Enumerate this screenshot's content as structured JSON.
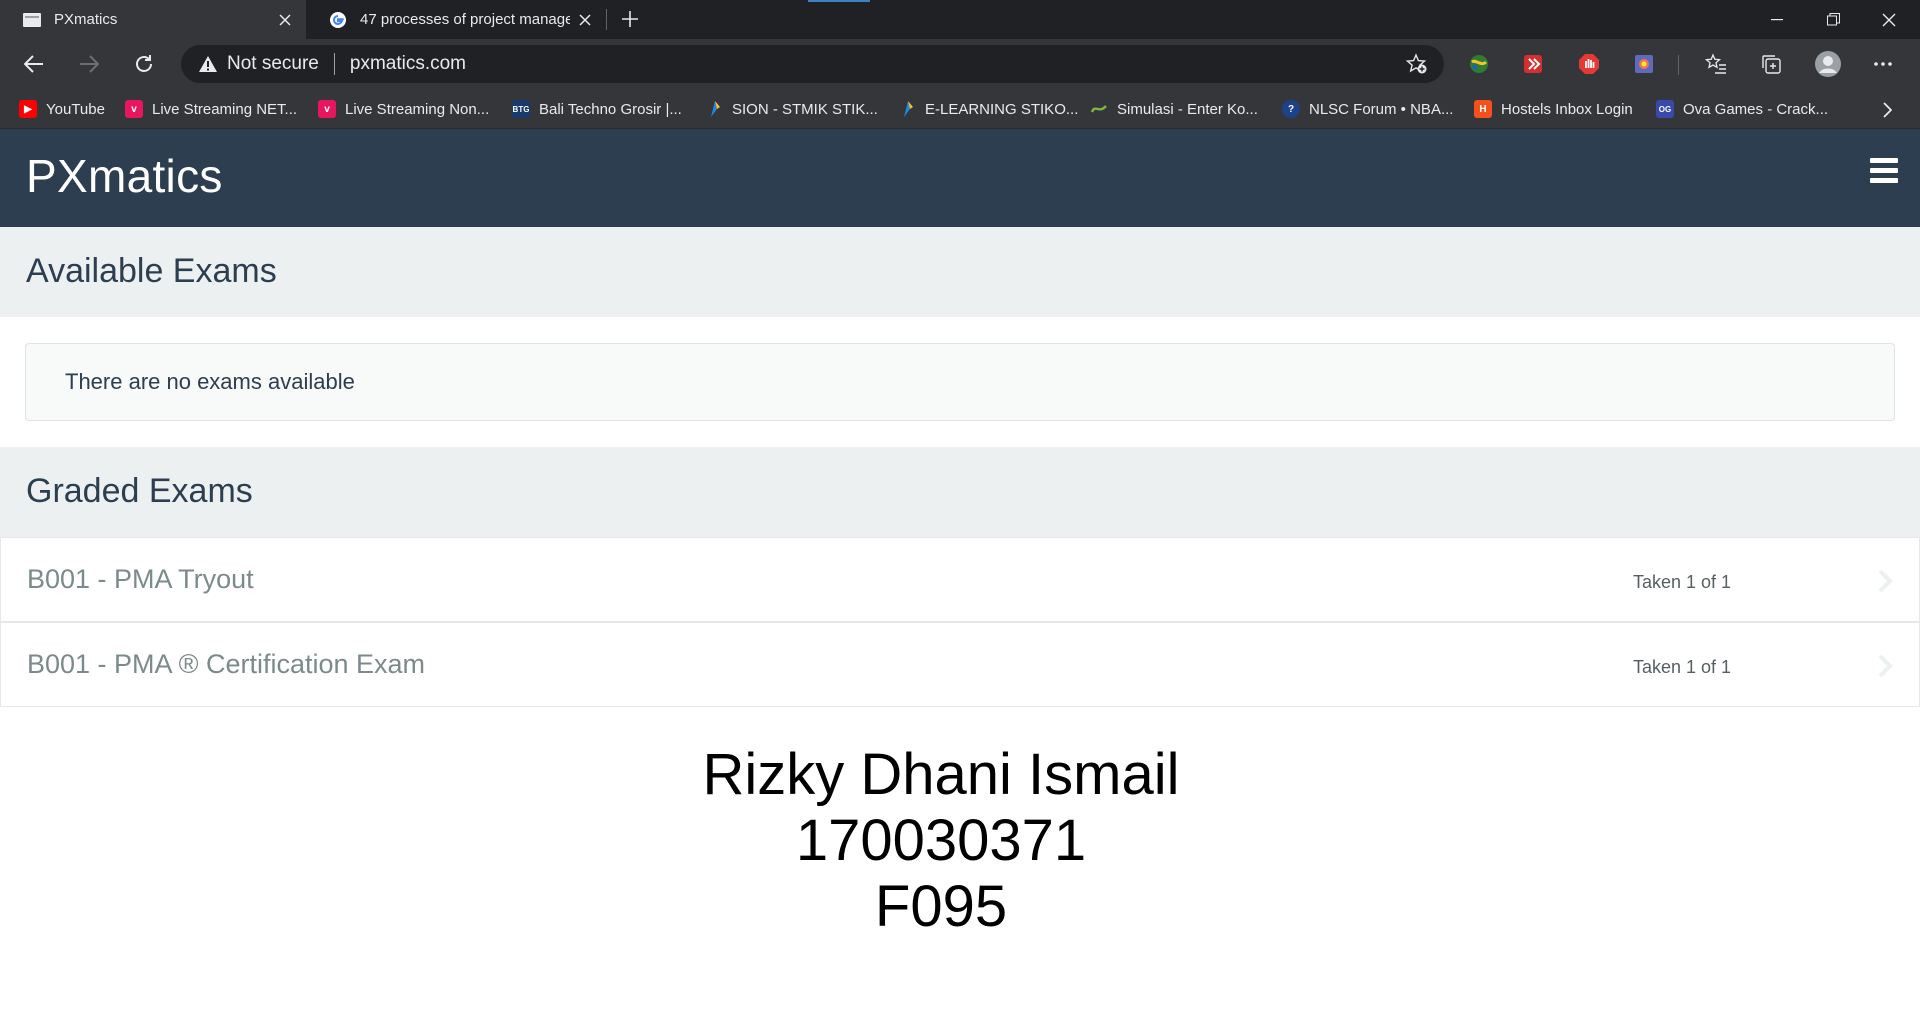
{
  "browser": {
    "tabs": [
      {
        "title": "PXmatics",
        "active": true
      },
      {
        "title": "47 processes of project managem",
        "active": false
      }
    ],
    "address": {
      "security_label": "Not secure",
      "url": "pxmatics.com"
    },
    "bookmarks": [
      {
        "label": "YouTube",
        "color": "#ff0000"
      },
      {
        "label": "Live Streaming NET...",
        "color": "#e8175d"
      },
      {
        "label": "Live Streaming Non...",
        "color": "#e8175d"
      },
      {
        "label": "Bali Techno Grosir |...",
        "color": "#1a3a6b"
      },
      {
        "label": "SION - STMIK STIK...",
        "color": "#1e88e5"
      },
      {
        "label": "E-LEARNING STIKO...",
        "color": "#1e88e5"
      },
      {
        "label": "Simulasi - Enter Ko...",
        "color": "#7cb342"
      },
      {
        "label": "NLSC Forum • NBA...",
        "color": "#1d428a"
      },
      {
        "label": "Hostels Inbox Login",
        "color": "#f4511e"
      },
      {
        "label": "Ova Games - Crack...",
        "color": "#3949ab"
      }
    ]
  },
  "site": {
    "brand": "PXmatics",
    "available": {
      "heading": "Available Exams",
      "empty_message": "There are no exams available"
    },
    "graded": {
      "heading": "Graded Exams",
      "items": [
        {
          "title": "B001 - PMA Tryout",
          "status": "Taken 1 of 1"
        },
        {
          "title": "B001 - PMA ® Certification Exam",
          "status": "Taken 1 of 1"
        }
      ]
    }
  },
  "overlay_text": {
    "name": "Rizky Dhani Ismail",
    "id": "170030371",
    "code": "F095"
  },
  "colors": {
    "navbar": "#2c3e50",
    "section_bg": "#ecf0f1",
    "chrome_dark": "#202124",
    "chrome_toolbar": "#35363a"
  }
}
